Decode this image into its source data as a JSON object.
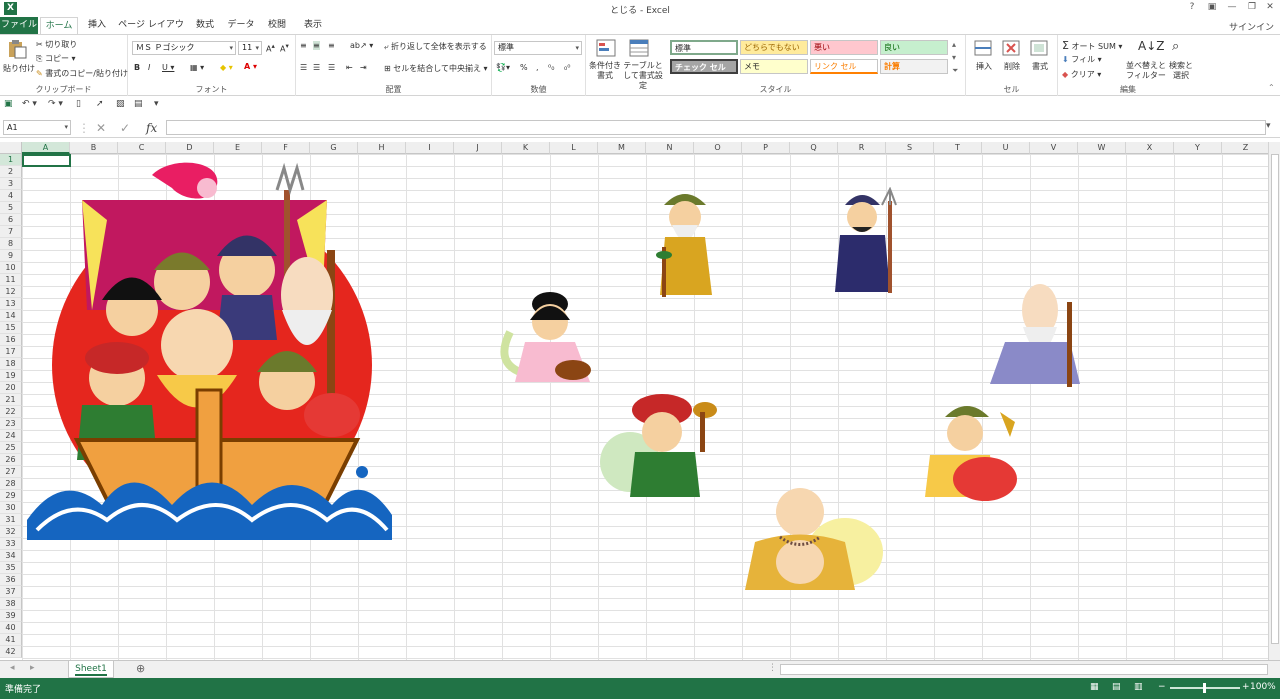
{
  "window": {
    "title": "とじる - Excel",
    "help": "?",
    "signin": "サインイン"
  },
  "tabs": [
    "ファイル",
    "ホーム",
    "挿入",
    "ページ レイアウト",
    "数式",
    "データ",
    "校閲",
    "表示"
  ],
  "ribbon": {
    "clipboard": {
      "paste": "貼り付け",
      "cut": "切り取り",
      "copy": "コピー",
      "format_painter": "書式のコピー/貼り付け",
      "label": "クリップボード"
    },
    "font": {
      "name": "ＭＳ Ｐゴシック",
      "size": "11",
      "label": "フォント"
    },
    "alignment": {
      "wrap": "折り返して全体を表示する",
      "merge": "セルを結合して中央揃え",
      "label": "配置"
    },
    "number": {
      "format": "標準",
      "label": "数値"
    },
    "styles": {
      "conditional": "条件付き書式",
      "table": "テーブルとして書式設定",
      "cells": [
        "標準",
        "どちらでもない",
        "悪い",
        "良い",
        "チェック セル",
        "メモ",
        "リンク セル",
        "計算"
      ],
      "label": "スタイル"
    },
    "cells": {
      "insert": "挿入",
      "delete": "削除",
      "format": "書式",
      "label": "セル"
    },
    "editing": {
      "autosum": "オート SUM",
      "fill": "フィル",
      "clear": "クリア",
      "sort": "並べ替えとフィルター",
      "find": "検索と選択",
      "label": "編集"
    }
  },
  "formula_bar": {
    "name_box": "A1",
    "fx": "fx",
    "value": ""
  },
  "columns": [
    "A",
    "B",
    "C",
    "D",
    "E",
    "F",
    "G",
    "H",
    "I",
    "J",
    "K",
    "L",
    "M",
    "N",
    "O",
    "P",
    "Q",
    "R",
    "S",
    "T",
    "U",
    "V",
    "W",
    "X",
    "Y",
    "Z"
  ],
  "rows": [
    "1",
    "2",
    "3",
    "4",
    "5",
    "6",
    "7",
    "8",
    "9",
    "10",
    "11",
    "12",
    "13",
    "14",
    "15",
    "16",
    "17",
    "18",
    "19",
    "20",
    "21",
    "22",
    "23",
    "24",
    "25",
    "26",
    "27",
    "28",
    "29",
    "30",
    "31",
    "32",
    "33",
    "34",
    "35",
    "36",
    "37",
    "38",
    "39",
    "40",
    "41",
    "42"
  ],
  "sheet": {
    "active_tab": "Sheet1"
  },
  "status": {
    "ready": "準備完了",
    "zoom": "100%"
  },
  "pictures": [
    "seven-gods-treasure-ship",
    "jurojin",
    "bishamonten",
    "benzaiten",
    "fukurokuju",
    "daikokuten",
    "ebisu",
    "hotei"
  ],
  "colors": {
    "accent": "#217346"
  }
}
